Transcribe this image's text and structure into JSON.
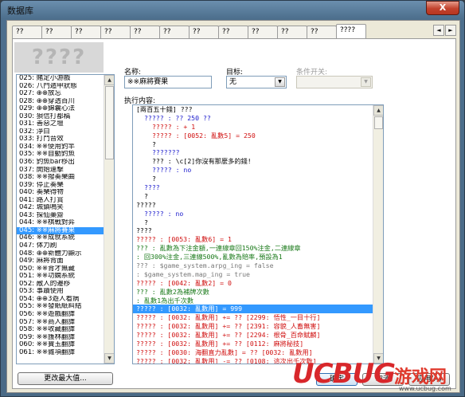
{
  "window": {
    "title": "数据库",
    "close_label": "X"
  },
  "tabs": [
    "??",
    "??",
    "??",
    "??",
    "??",
    "??",
    "??",
    "??",
    "??",
    "??",
    "??",
    "????"
  ],
  "tab_nav": {
    "prev": "◄",
    "next": "►"
  },
  "watermark_text": "????",
  "event_list": [
    "025: 賭定小游戲",
    "026: 八門遁甲狀態",
    "027: ⊕⊕放忘",
    "028: ⊕⊕穿透百川",
    "029: ⊕⊕錦囊心法",
    "030: 狽信打都稿",
    "031: 善惡之壇",
    "032: 淨白",
    "033: 打鬥音效",
    "034: ※※使用釣竿",
    "035: ※※自動釣魚",
    "036: 釣魚bar移出",
    "037: 開始連擊",
    "038: ※※撥奏樂曲",
    "039: 停止奏樂",
    "040: 奏樂得物",
    "041: 路人打賞",
    "042: 城鎮鳴笑",
    "043: 探仙藥齋",
    "044: ※※棋戰對弈",
    "045: ※※麻將賽果",
    "046: ※※成就系統",
    "047: 体力刷",
    "048: ⊕⊕新體力顯示",
    "049: 麻將背面",
    "050: ※※背才無藏",
    "051: ※※功嫻系統",
    "052: 敵人的遷移",
    "053: 事蹟使用",
    "054: ⊕⊕3遊人看病",
    "055: ※※發紙紙糾結",
    "056: ※※遊戲翻譯",
    "057: ※※商人翻譯",
    "058: ※※收藏翻譯",
    "059: ※※護林翻譯",
    "060: ※※寶玉翻譯",
    "061: ※※雜項翻譯"
  ],
  "selected_event_index": 20,
  "change_max_label": "更改最大值...",
  "form": {
    "name_label": "名称:",
    "name_value": "※※麻將賽果",
    "target_label": "目标:",
    "target_value": "无",
    "switch_label": "条件开关:",
    "switch_value": "",
    "content_label": "执行内容:"
  },
  "script_lines": [
    {
      "text": "[兩百五十錢] ???",
      "color": "black",
      "indent": 0
    },
    {
      "text": "????? : ?? 250 ??",
      "color": "blue",
      "indent": 1
    },
    {
      "text": "????? : + 1",
      "color": "red",
      "indent": 2
    },
    {
      "text": "????? : [0052: 亂數5] = 250",
      "color": "red",
      "indent": 2
    },
    {
      "text": "?",
      "color": "black",
      "indent": 2
    },
    {
      "text": "???????",
      "color": "blue",
      "indent": 2
    },
    {
      "text": "??? : \\c[2]你沒有那麼多的錢!",
      "color": "black",
      "indent": 2
    },
    {
      "text": "????? : no",
      "color": "blue",
      "indent": 2
    },
    {
      "text": "?",
      "color": "black",
      "indent": 2
    },
    {
      "text": "????",
      "color": "blue",
      "indent": 1
    },
    {
      "text": "?",
      "color": "black",
      "indent": 1
    },
    {
      "text": "?????",
      "color": "black",
      "indent": 0
    },
    {
      "text": "????? : no",
      "color": "blue",
      "indent": 1
    },
    {
      "text": "?",
      "color": "black",
      "indent": 1
    },
    {
      "text": "????",
      "color": "black",
      "indent": 0
    },
    {
      "text": "????? : [0053: 亂數6] = 1",
      "color": "red",
      "indent": 0
    },
    {
      "text": "??? : 亂數為下注金額,一連線章回150%注金,二連線章",
      "color": "green",
      "indent": 0
    },
    {
      "text": "  : 回300%注金,三連線500%,亂數為賠率,預設為1",
      "color": "green",
      "indent": 0
    },
    {
      "text": "??? : $game_system.arpg_ing = false",
      "color": "gray",
      "indent": 0
    },
    {
      "text": "  : $game_system.map_ing = true",
      "color": "gray",
      "indent": 0
    },
    {
      "text": "????? : [0042: 亂數2] = 0",
      "color": "red",
      "indent": 0
    },
    {
      "text": "??? : 亂數2為補牌次數",
      "color": "green",
      "indent": 0
    },
    {
      "text": "  : 亂數1為出千次數",
      "color": "green",
      "indent": 0
    },
    {
      "text": "????? : [0032: 亂數用] = 999",
      "color": "red",
      "indent": 0
    },
    {
      "text": "????? : [0032: 亂數用] += ?? [2299: 悟性_一目十行]",
      "color": "red",
      "indent": 0
    },
    {
      "text": "????? : [0032: 亂數用] += ?? [2391: 容貌_人畜無害]",
      "color": "red",
      "indent": 0
    },
    {
      "text": "????? : [0032: 亂數用] += ?? [2294: 根骨_百命賦麟]",
      "color": "red",
      "indent": 0
    },
    {
      "text": "????? : [0032: 亂數用] += ?? [0112: 麻將秘技]",
      "color": "red",
      "indent": 0
    },
    {
      "text": "????? : [0030: 海翻直力亂數] = ?? [0032: 亂數用]",
      "color": "red",
      "indent": 0
    },
    {
      "text": "????? : [0032: 亂數用] -= ?? [0108: 這次出千次數]",
      "color": "red",
      "indent": 0
    }
  ],
  "selected_script_index": 23,
  "buttons": {
    "ok": "确定",
    "cancel": "取消",
    "apply": "应用(A)"
  },
  "watermark_brand": {
    "brand": "UCBUG",
    "cn": "游戏网",
    "url": "www.ucbug.com"
  },
  "colors": {
    "black": "#000000",
    "blue": "#1a1acc",
    "red": "#d01010",
    "green": "#1a7a1a",
    "gray": "#7a7a7a",
    "selection": "#3399ff"
  }
}
